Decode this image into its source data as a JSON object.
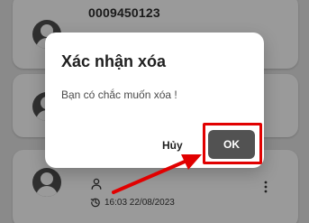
{
  "colors": {
    "overlay": "#8a8a8a",
    "card": "#9a9a9a",
    "dialog": "#ffffff",
    "ok_button": "#525252",
    "highlight": "#e10000"
  },
  "cards": [
    {
      "phone": "0009450123"
    },
    {},
    {
      "history": "16:03 22/08/2023"
    }
  ],
  "dialog": {
    "title": "Xác nhận xóa",
    "message": "Bạn có chắc muốn xóa !",
    "cancel_label": "Hủy",
    "ok_label": "OK"
  },
  "icons": {
    "avatar": "avatar-icon",
    "person": "person-icon",
    "history": "history-icon",
    "more": "more-vertical-icon"
  }
}
